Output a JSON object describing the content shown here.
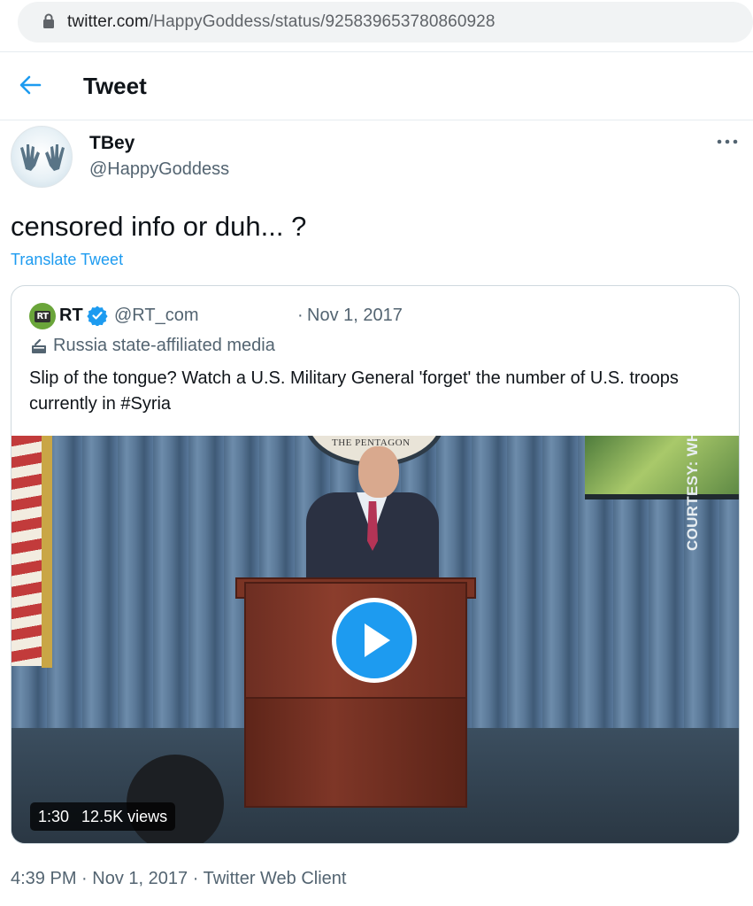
{
  "browser": {
    "url_host": "twitter.com",
    "url_path": "/HappyGoddess/status/925839653780860928",
    "icons": {
      "lock": "lock-icon"
    }
  },
  "header": {
    "title": "Tweet",
    "back_icon": "back-arrow-icon"
  },
  "tweet": {
    "author_name": "TBey",
    "author_handle": "@HappyGoddess",
    "text": "censored info or duh... ?",
    "translate_label": "Translate Tweet",
    "time": "4:39 PM",
    "separator": "·",
    "date": "Nov 1, 2017",
    "client": "Twitter Web Client"
  },
  "quote": {
    "logo_text": "RT",
    "name": "RT",
    "handle": "@RT_com",
    "separator": "·",
    "date": "Nov 1, 2017",
    "label": "Russia state-affiliated media",
    "text": "Slip of the tongue? Watch a U.S. Military General 'forget' the number of U.S. troops currently in #Syria",
    "video": {
      "duration": "1:30",
      "views": "12.5K views",
      "watermark": "COURTESY: WHITE HOUSE",
      "seal_text": "THE PENTAGON"
    }
  },
  "colors": {
    "accent": "#1d9bf0",
    "text_primary": "#0f1419",
    "text_secondary": "#536471",
    "border": "#cfd9de"
  }
}
